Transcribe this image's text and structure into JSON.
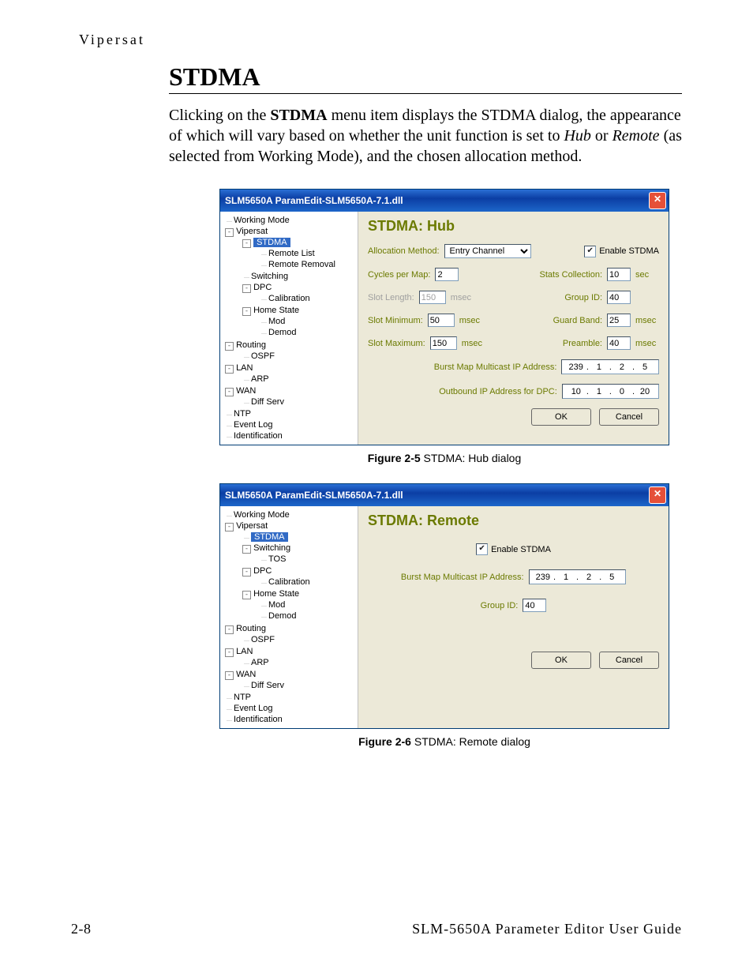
{
  "running_head": "Vipersat",
  "section_title": "STDMA",
  "body_html": "Clicking on the <b>STDMA</b> menu item displays the STDMA dialog, the appearance of which will vary based on whether the unit function is set to <i>Hub</i> or <i>Remote</i> (as selected from Working Mode), and the chosen allocation method.",
  "dialog_title": "SLM5650A ParamEdit-SLM5650A-7.1.dll",
  "close_glyph": "✕",
  "tree_hub": [
    "Working Mode",
    "Vipersat",
    "STDMA",
    "Remote List",
    "Remote Removal",
    "Switching",
    "DPC",
    "Calibration",
    "Home State",
    "Mod",
    "Demod",
    "Routing",
    "OSPF",
    "LAN",
    "ARP",
    "WAN",
    "Diff Serv",
    "NTP",
    "Event Log",
    "Identification"
  ],
  "tree_remote": [
    "Working Mode",
    "Vipersat",
    "STDMA",
    "Switching",
    "TOS",
    "DPC",
    "Calibration",
    "Home State",
    "Mod",
    "Demod",
    "Routing",
    "OSPF",
    "LAN",
    "ARP",
    "WAN",
    "Diff Serv",
    "NTP",
    "Event Log",
    "Identification"
  ],
  "hub": {
    "title": "STDMA: Hub",
    "alloc_label": "Allocation Method:",
    "alloc_value": "Entry Channel",
    "enable_label": "Enable STDMA",
    "cycles_label": "Cycles per Map:",
    "cycles_value": "2",
    "stats_label": "Stats Collection:",
    "stats_value": "10",
    "stats_unit": "sec",
    "slotlen_label": "Slot Length:",
    "slotlen_value": "150",
    "slotlen_unit": "msec",
    "groupid_label": "Group ID:",
    "groupid_value": "40",
    "slotmin_label": "Slot Minimum:",
    "slotmin_value": "50",
    "slotmin_unit": "msec",
    "guard_label": "Guard Band:",
    "guard_value": "25",
    "guard_unit": "msec",
    "slotmax_label": "Slot Maximum:",
    "slotmax_value": "150",
    "slotmax_unit": "msec",
    "preamble_label": "Preamble:",
    "preamble_value": "40",
    "preamble_unit": "msec",
    "burst_label": "Burst Map Multicast IP Address:",
    "burst_ip": [
      "239",
      "1",
      "2",
      "5"
    ],
    "dpc_label": "Outbound IP Address for DPC:",
    "dpc_ip": [
      "10",
      "1",
      "0",
      "20"
    ]
  },
  "remote": {
    "title": "STDMA: Remote",
    "enable_label": "Enable STDMA",
    "burst_label": "Burst Map Multicast IP Address:",
    "burst_ip": [
      "239",
      "1",
      "2",
      "5"
    ],
    "groupid_label": "Group ID:",
    "groupid_value": "40"
  },
  "buttons": {
    "ok": "OK",
    "cancel": "Cancel"
  },
  "caption1_b": "Figure 2-5",
  "caption1_t": "   STDMA: Hub dialog",
  "caption2_b": "Figure 2-6",
  "caption2_t": "   STDMA: Remote dialog",
  "footer_left": "2-8",
  "footer_right": "SLM-5650A Parameter Editor User Guide"
}
